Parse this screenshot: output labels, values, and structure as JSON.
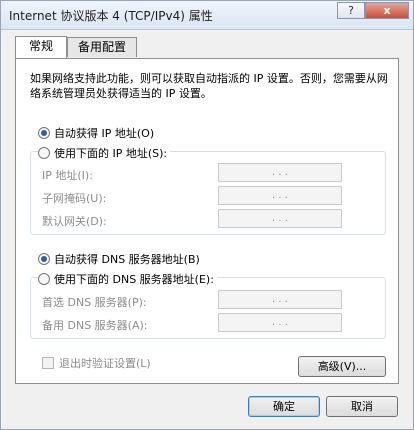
{
  "window": {
    "title": "Internet 协议版本 4 (TCP/IPv4) 属性",
    "help_label": "?",
    "close_label": "x"
  },
  "tabs": [
    {
      "label": "常规",
      "active": true
    },
    {
      "label": "备用配置",
      "active": false
    }
  ],
  "intro": "如果网络支持此功能，则可以获取自动指派的 IP 设置。否则，您需要从网络系统管理员处获得适当的 IP 设置。",
  "ip": {
    "auto_label": "自动获得 IP 地址(O)",
    "manual_label": "使用下面的 IP 地址(S):",
    "selected": "auto",
    "fields": [
      {
        "label": "IP 地址(I):",
        "value": ". . ."
      },
      {
        "label": "子网掩码(U):",
        "value": ". . ."
      },
      {
        "label": "默认网关(D):",
        "value": ". . ."
      }
    ]
  },
  "dns": {
    "auto_label": "自动获得 DNS 服务器地址(B)",
    "manual_label": "使用下面的 DNS 服务器地址(E):",
    "selected": "auto",
    "fields": [
      {
        "label": "首选 DNS 服务器(P):",
        "value": ". . ."
      },
      {
        "label": "备用 DNS 服务器(A):",
        "value": ". . ."
      }
    ]
  },
  "validate_label": "退出时验证设置(L)",
  "advanced_label": "高级(V)...",
  "ok_label": "确定",
  "cancel_label": "取消"
}
